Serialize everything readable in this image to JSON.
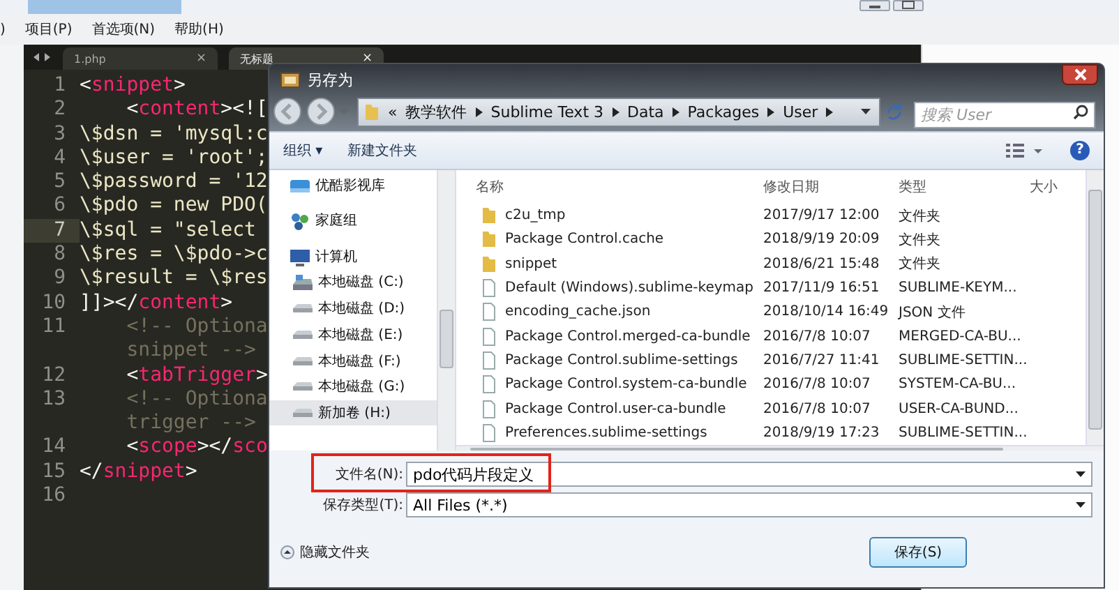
{
  "menu": [
    {
      "label": ")"
    },
    {
      "label": "项目(P)"
    },
    {
      "label": "首选项(N)"
    },
    {
      "label": "帮助(H)"
    }
  ],
  "editor": {
    "tabs": [
      {
        "label": "1.php",
        "selected": false,
        "close": "×"
      },
      {
        "label": "无标题",
        "selected": true,
        "close": "×"
      }
    ],
    "lines": [
      {
        "number": "1",
        "current": false,
        "rows": [
          [
            {
              "kind": "punct",
              "text": "<"
            },
            {
              "kind": "tag",
              "text": "snippet"
            },
            {
              "kind": "punct",
              "text": ">"
            }
          ]
        ]
      },
      {
        "number": "2",
        "current": false,
        "rows": [
          [
            {
              "kind": "indent",
              "text": "    "
            },
            {
              "kind": "punct",
              "text": "<"
            },
            {
              "kind": "tag",
              "text": "content"
            },
            {
              "kind": "punct",
              "text": "><!["
            }
          ]
        ]
      },
      {
        "number": "3",
        "current": false,
        "rows": [
          [
            {
              "kind": "text",
              "text": "\\$dsn = 'mysql:c"
            }
          ]
        ]
      },
      {
        "number": "4",
        "current": false,
        "rows": [
          [
            {
              "kind": "text",
              "text": "\\$user = 'root';"
            }
          ]
        ]
      },
      {
        "number": "5",
        "current": false,
        "rows": [
          [
            {
              "kind": "text",
              "text": "\\$password = '12"
            }
          ]
        ]
      },
      {
        "number": "6",
        "current": false,
        "rows": [
          [
            {
              "kind": "text",
              "text": "\\$pdo = new PDO("
            }
          ]
        ]
      },
      {
        "number": "7",
        "current": true,
        "rows": [
          [
            {
              "kind": "text",
              "text": "\\$sql = \"select"
            }
          ]
        ]
      },
      {
        "number": "8",
        "current": false,
        "rows": [
          [
            {
              "kind": "text",
              "text": "\\$res = \\$pdo->c"
            }
          ]
        ]
      },
      {
        "number": "9",
        "current": false,
        "rows": [
          [
            {
              "kind": "text",
              "text": "\\$result = \\$res"
            }
          ]
        ]
      },
      {
        "number": "10",
        "current": false,
        "rows": [
          [
            {
              "kind": "punct",
              "text": "]]></"
            },
            {
              "kind": "tag",
              "text": "content"
            },
            {
              "kind": "punct",
              "text": ">"
            }
          ]
        ]
      },
      {
        "number": "11",
        "current": false,
        "rows": [
          [
            {
              "kind": "indent",
              "text": "    "
            },
            {
              "kind": "comment",
              "text": "<!-- Optiona"
            }
          ],
          [
            {
              "kind": "indent",
              "text": "    "
            },
            {
              "kind": "comment",
              "text": "snippet -->"
            }
          ]
        ]
      },
      {
        "number": "12",
        "current": false,
        "rows": [
          [
            {
              "kind": "indent",
              "text": "    "
            },
            {
              "kind": "punct",
              "text": "<"
            },
            {
              "kind": "tag",
              "text": "tabTrigger"
            },
            {
              "kind": "punct",
              "text": ">"
            }
          ]
        ]
      },
      {
        "number": "13",
        "current": false,
        "rows": [
          [
            {
              "kind": "indent",
              "text": "    "
            },
            {
              "kind": "comment",
              "text": "<!-- Optiona"
            }
          ],
          [
            {
              "kind": "indent",
              "text": "    "
            },
            {
              "kind": "comment",
              "text": "trigger -->"
            }
          ]
        ]
      },
      {
        "number": "14",
        "current": false,
        "rows": [
          [
            {
              "kind": "indent",
              "text": "    "
            },
            {
              "kind": "punct",
              "text": "<"
            },
            {
              "kind": "tag",
              "text": "scope"
            },
            {
              "kind": "punct",
              "text": "></"
            },
            {
              "kind": "tag",
              "text": "sco"
            }
          ]
        ]
      },
      {
        "number": "15",
        "current": false,
        "rows": [
          [
            {
              "kind": "punct",
              "text": "</"
            },
            {
              "kind": "tag",
              "text": "snippet"
            },
            {
              "kind": "punct",
              "text": ">"
            }
          ]
        ]
      },
      {
        "number": "16",
        "current": false,
        "rows": [
          []
        ]
      }
    ]
  },
  "dialog": {
    "title": "另存为",
    "address": {
      "overflow": "«",
      "crumbs": [
        "教学软件",
        "Sublime Text 3",
        "Data",
        "Packages",
        "User"
      ]
    },
    "search": {
      "placeholder": "搜索 User"
    },
    "toolbar": {
      "organize": "组织 ▾",
      "new_folder": "新建文件夹",
      "help": "?"
    },
    "nav": [
      {
        "kind": "library",
        "label": "优酷影视库",
        "selected": false
      },
      {
        "kind": "homegroup",
        "label": "家庭组",
        "selected": false
      },
      {
        "kind": "computer",
        "label": "计算机",
        "selected": false
      },
      {
        "kind": "system-drive",
        "label": "本地磁盘 (C:)",
        "selected": false
      },
      {
        "kind": "drive",
        "label": "本地磁盘 (D:)",
        "selected": false
      },
      {
        "kind": "drive",
        "label": "本地磁盘 (E:)",
        "selected": false
      },
      {
        "kind": "drive",
        "label": "本地磁盘 (F:)",
        "selected": false
      },
      {
        "kind": "drive",
        "label": "本地磁盘 (G:)",
        "selected": false
      },
      {
        "kind": "drive",
        "label": "新加卷 (H:)",
        "selected": true
      }
    ],
    "columns": [
      "名称",
      "修改日期",
      "类型",
      "大小"
    ],
    "files": [
      {
        "kind": "folder",
        "name": "c2u_tmp",
        "date": "2017/9/17 12:00",
        "type": "文件夹"
      },
      {
        "kind": "folder",
        "name": "Package Control.cache",
        "date": "2018/9/19 20:09",
        "type": "文件夹"
      },
      {
        "kind": "folder",
        "name": "snippet",
        "date": "2018/6/21 15:48",
        "type": "文件夹"
      },
      {
        "kind": "file",
        "name": "Default (Windows).sublime-keymap",
        "date": "2017/11/9 16:51",
        "type": "SUBLIME-KEYM..."
      },
      {
        "kind": "file",
        "name": "encoding_cache.json",
        "date": "2018/10/14 16:49",
        "type": "JSON 文件"
      },
      {
        "kind": "file",
        "name": "Package Control.merged-ca-bundle",
        "date": "2016/7/8 10:07",
        "type": "MERGED-CA-BU..."
      },
      {
        "kind": "file",
        "name": "Package Control.sublime-settings",
        "date": "2016/7/27 11:41",
        "type": "SUBLIME-SETTIN..."
      },
      {
        "kind": "file",
        "name": "Package Control.system-ca-bundle",
        "date": "2016/7/8 10:07",
        "type": "SYSTEM-CA-BU..."
      },
      {
        "kind": "file",
        "name": "Package Control.user-ca-bundle",
        "date": "2016/7/8 10:07",
        "type": "USER-CA-BUND..."
      },
      {
        "kind": "file",
        "name": "Preferences.sublime-settings",
        "date": "2018/9/19 17:23",
        "type": "SUBLIME-SETTIN..."
      }
    ],
    "filename": {
      "label": "文件名(N):",
      "value": "pdo代码片段定义",
      "highlighted": true
    },
    "filetype": {
      "label": "保存类型(T):",
      "value": "All Files (*.*)"
    },
    "hide_folders": "隐藏文件夹",
    "save": "保存(S)"
  }
}
